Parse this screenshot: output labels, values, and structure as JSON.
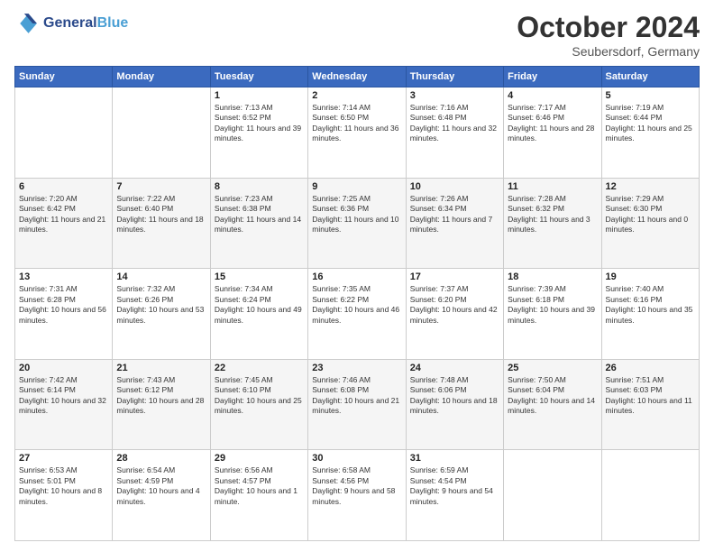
{
  "header": {
    "logo_text_general": "General",
    "logo_text_blue": "Blue",
    "month_title": "October 2024",
    "location": "Seubersdorf, Germany"
  },
  "days_of_week": [
    "Sunday",
    "Monday",
    "Tuesday",
    "Wednesday",
    "Thursday",
    "Friday",
    "Saturday"
  ],
  "weeks": [
    [
      null,
      null,
      {
        "day": "1",
        "sunrise": "Sunrise: 7:13 AM",
        "sunset": "Sunset: 6:52 PM",
        "daylight": "Daylight: 11 hours and 39 minutes."
      },
      {
        "day": "2",
        "sunrise": "Sunrise: 7:14 AM",
        "sunset": "Sunset: 6:50 PM",
        "daylight": "Daylight: 11 hours and 36 minutes."
      },
      {
        "day": "3",
        "sunrise": "Sunrise: 7:16 AM",
        "sunset": "Sunset: 6:48 PM",
        "daylight": "Daylight: 11 hours and 32 minutes."
      },
      {
        "day": "4",
        "sunrise": "Sunrise: 7:17 AM",
        "sunset": "Sunset: 6:46 PM",
        "daylight": "Daylight: 11 hours and 28 minutes."
      },
      {
        "day": "5",
        "sunrise": "Sunrise: 7:19 AM",
        "sunset": "Sunset: 6:44 PM",
        "daylight": "Daylight: 11 hours and 25 minutes."
      }
    ],
    [
      {
        "day": "6",
        "sunrise": "Sunrise: 7:20 AM",
        "sunset": "Sunset: 6:42 PM",
        "daylight": "Daylight: 11 hours and 21 minutes."
      },
      {
        "day": "7",
        "sunrise": "Sunrise: 7:22 AM",
        "sunset": "Sunset: 6:40 PM",
        "daylight": "Daylight: 11 hours and 18 minutes."
      },
      {
        "day": "8",
        "sunrise": "Sunrise: 7:23 AM",
        "sunset": "Sunset: 6:38 PM",
        "daylight": "Daylight: 11 hours and 14 minutes."
      },
      {
        "day": "9",
        "sunrise": "Sunrise: 7:25 AM",
        "sunset": "Sunset: 6:36 PM",
        "daylight": "Daylight: 11 hours and 10 minutes."
      },
      {
        "day": "10",
        "sunrise": "Sunrise: 7:26 AM",
        "sunset": "Sunset: 6:34 PM",
        "daylight": "Daylight: 11 hours and 7 minutes."
      },
      {
        "day": "11",
        "sunrise": "Sunrise: 7:28 AM",
        "sunset": "Sunset: 6:32 PM",
        "daylight": "Daylight: 11 hours and 3 minutes."
      },
      {
        "day": "12",
        "sunrise": "Sunrise: 7:29 AM",
        "sunset": "Sunset: 6:30 PM",
        "daylight": "Daylight: 11 hours and 0 minutes."
      }
    ],
    [
      {
        "day": "13",
        "sunrise": "Sunrise: 7:31 AM",
        "sunset": "Sunset: 6:28 PM",
        "daylight": "Daylight: 10 hours and 56 minutes."
      },
      {
        "day": "14",
        "sunrise": "Sunrise: 7:32 AM",
        "sunset": "Sunset: 6:26 PM",
        "daylight": "Daylight: 10 hours and 53 minutes."
      },
      {
        "day": "15",
        "sunrise": "Sunrise: 7:34 AM",
        "sunset": "Sunset: 6:24 PM",
        "daylight": "Daylight: 10 hours and 49 minutes."
      },
      {
        "day": "16",
        "sunrise": "Sunrise: 7:35 AM",
        "sunset": "Sunset: 6:22 PM",
        "daylight": "Daylight: 10 hours and 46 minutes."
      },
      {
        "day": "17",
        "sunrise": "Sunrise: 7:37 AM",
        "sunset": "Sunset: 6:20 PM",
        "daylight": "Daylight: 10 hours and 42 minutes."
      },
      {
        "day": "18",
        "sunrise": "Sunrise: 7:39 AM",
        "sunset": "Sunset: 6:18 PM",
        "daylight": "Daylight: 10 hours and 39 minutes."
      },
      {
        "day": "19",
        "sunrise": "Sunrise: 7:40 AM",
        "sunset": "Sunset: 6:16 PM",
        "daylight": "Daylight: 10 hours and 35 minutes."
      }
    ],
    [
      {
        "day": "20",
        "sunrise": "Sunrise: 7:42 AM",
        "sunset": "Sunset: 6:14 PM",
        "daylight": "Daylight: 10 hours and 32 minutes."
      },
      {
        "day": "21",
        "sunrise": "Sunrise: 7:43 AM",
        "sunset": "Sunset: 6:12 PM",
        "daylight": "Daylight: 10 hours and 28 minutes."
      },
      {
        "day": "22",
        "sunrise": "Sunrise: 7:45 AM",
        "sunset": "Sunset: 6:10 PM",
        "daylight": "Daylight: 10 hours and 25 minutes."
      },
      {
        "day": "23",
        "sunrise": "Sunrise: 7:46 AM",
        "sunset": "Sunset: 6:08 PM",
        "daylight": "Daylight: 10 hours and 21 minutes."
      },
      {
        "day": "24",
        "sunrise": "Sunrise: 7:48 AM",
        "sunset": "Sunset: 6:06 PM",
        "daylight": "Daylight: 10 hours and 18 minutes."
      },
      {
        "day": "25",
        "sunrise": "Sunrise: 7:50 AM",
        "sunset": "Sunset: 6:04 PM",
        "daylight": "Daylight: 10 hours and 14 minutes."
      },
      {
        "day": "26",
        "sunrise": "Sunrise: 7:51 AM",
        "sunset": "Sunset: 6:03 PM",
        "daylight": "Daylight: 10 hours and 11 minutes."
      }
    ],
    [
      {
        "day": "27",
        "sunrise": "Sunrise: 6:53 AM",
        "sunset": "Sunset: 5:01 PM",
        "daylight": "Daylight: 10 hours and 8 minutes."
      },
      {
        "day": "28",
        "sunrise": "Sunrise: 6:54 AM",
        "sunset": "Sunset: 4:59 PM",
        "daylight": "Daylight: 10 hours and 4 minutes."
      },
      {
        "day": "29",
        "sunrise": "Sunrise: 6:56 AM",
        "sunset": "Sunset: 4:57 PM",
        "daylight": "Daylight: 10 hours and 1 minute."
      },
      {
        "day": "30",
        "sunrise": "Sunrise: 6:58 AM",
        "sunset": "Sunset: 4:56 PM",
        "daylight": "Daylight: 9 hours and 58 minutes."
      },
      {
        "day": "31",
        "sunrise": "Sunrise: 6:59 AM",
        "sunset": "Sunset: 4:54 PM",
        "daylight": "Daylight: 9 hours and 54 minutes."
      },
      null,
      null
    ]
  ]
}
